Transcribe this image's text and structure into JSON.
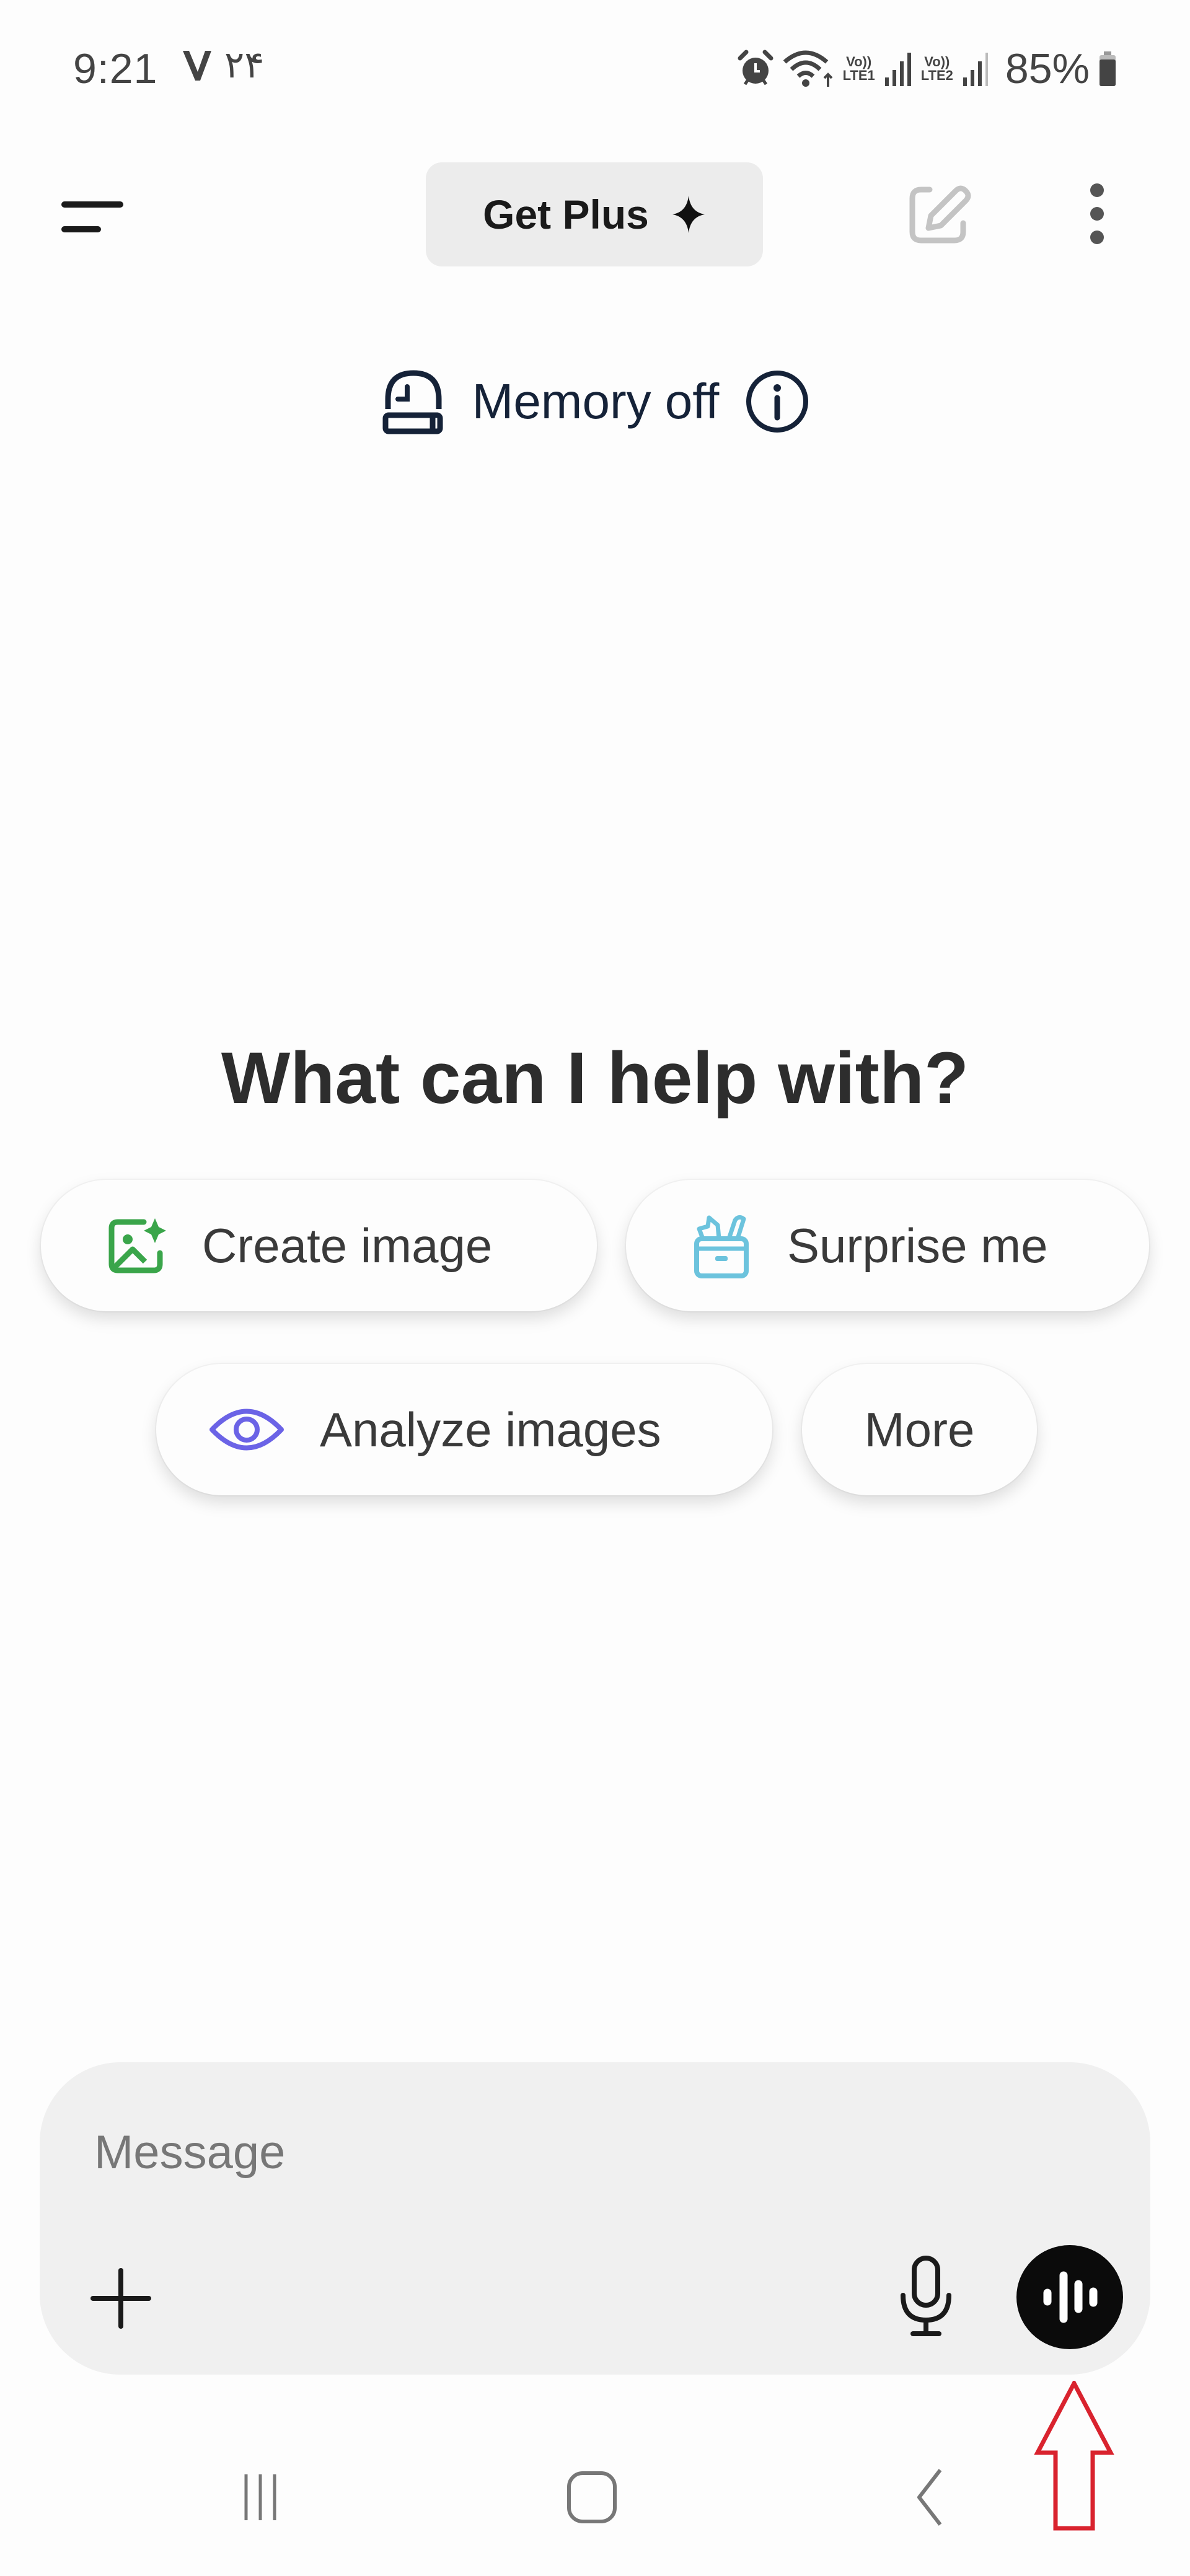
{
  "status_bar": {
    "time": "9:21",
    "notification_icon": "v-check-icon",
    "farsi_date": "۲۴",
    "icons": [
      "alarm-icon",
      "wifi-icon",
      "lte1-signal-icon",
      "lte2-signal-icon",
      "battery-icon"
    ],
    "lte1": {
      "vo": "Vo))",
      "label": "LTE1"
    },
    "lte2": {
      "vo": "Vo))",
      "label": "LTE2"
    },
    "battery_percent": "85%",
    "battery_level": 0.85
  },
  "header": {
    "menu_icon": "menu-icon",
    "get_plus_label": "Get Plus",
    "get_plus_icon": "sparkle-icon",
    "new_chat_icon": "edit-icon",
    "more_icon": "more-vertical-icon"
  },
  "memory": {
    "icon": "memory-icon",
    "label": "Memory off",
    "info_icon": "info-icon"
  },
  "main": {
    "heading": "What can I help with?",
    "suggestions": [
      {
        "label": "Create image",
        "icon": "image-create-icon",
        "color": "#3aa54a"
      },
      {
        "label": "Surprise me",
        "icon": "gift-box-icon",
        "color": "#6cc3dd"
      },
      {
        "label": "Analyze images",
        "icon": "eye-icon",
        "color": "#6b63e6"
      },
      {
        "label": "More",
        "icon": "",
        "color": ""
      }
    ]
  },
  "composer": {
    "placeholder": "Message",
    "value": "",
    "attach_icon": "plus-icon",
    "dictate_icon": "microphone-icon",
    "voice_mode_icon": "voice-waveform-icon"
  },
  "annotation": {
    "type": "arrow",
    "color": "#d9232e",
    "target": "voice-mode-button"
  },
  "nav_bar": {
    "recents_icon": "recents-icon",
    "home_icon": "home-icon",
    "back_icon": "back-icon"
  }
}
